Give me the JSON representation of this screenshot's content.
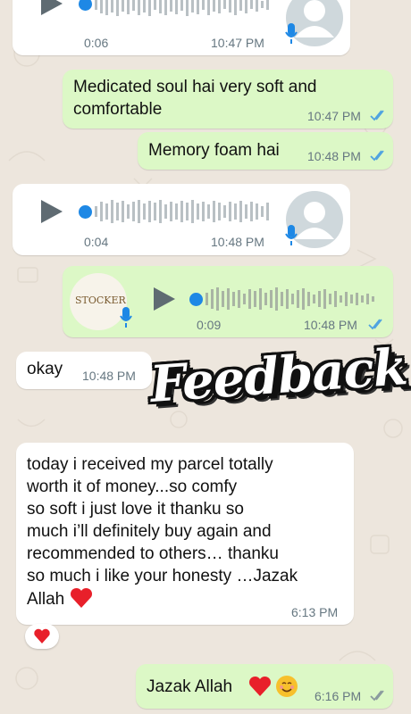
{
  "colors": {
    "incoming_bubble": "#ffffff",
    "outgoing_bubble": "#dcf8c6",
    "tick_read": "#4fa3e0",
    "voice_dot": "#1e88e5",
    "heart": "#e8202a"
  },
  "voice1": {
    "duration": "0:06",
    "time": "10:47 PM",
    "icon": "avatar-placeholder-icon"
  },
  "msg_medicated": {
    "text": "Medicated soul hai very soft and comfortable",
    "line1": "Medicated soul hai very soft and",
    "line2": "comfortable",
    "time": "10:47 PM"
  },
  "msg_memory": {
    "text": "Memory foam hai",
    "time": "10:48 PM"
  },
  "voice2": {
    "duration": "0:04",
    "time": "10:48 PM"
  },
  "voice3": {
    "duration": "0:09",
    "time": "10:48 PM",
    "avatar_text": "STOCKER"
  },
  "msg_okay": {
    "text": "okay",
    "time": "10:48 PM"
  },
  "overlay": {
    "title": "Feedback"
  },
  "msg_review": {
    "lines": [
      "today i received my parcel totally",
      "worth it of money...so comfy",
      "so soft i just love it thanku so",
      "much i’ll definitely buy again and",
      "recommended to others… thanku",
      "so much i like your honesty …Jazak",
      "Allah"
    ],
    "time": "6:13 PM",
    "reaction": "heart"
  },
  "msg_reply": {
    "text": "Jazak Allah",
    "time": "6:16 PM"
  }
}
